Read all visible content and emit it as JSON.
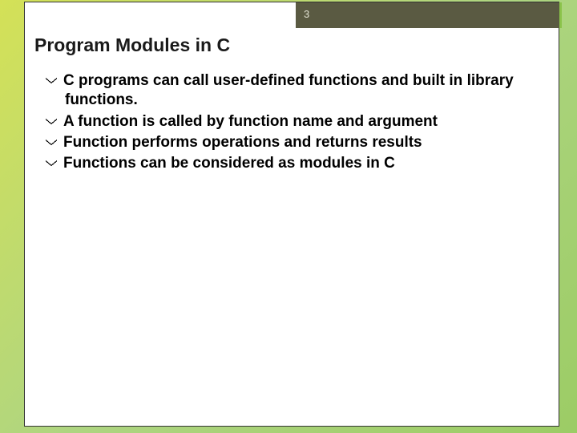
{
  "page_number": "3",
  "title": "Program Modules in C",
  "bullets": [
    "C programs can call user-defined functions and built in library functions.",
    "A function is called by function name and argument",
    "Function performs operations and returns results",
    "Functions can be considered as modules in C"
  ]
}
